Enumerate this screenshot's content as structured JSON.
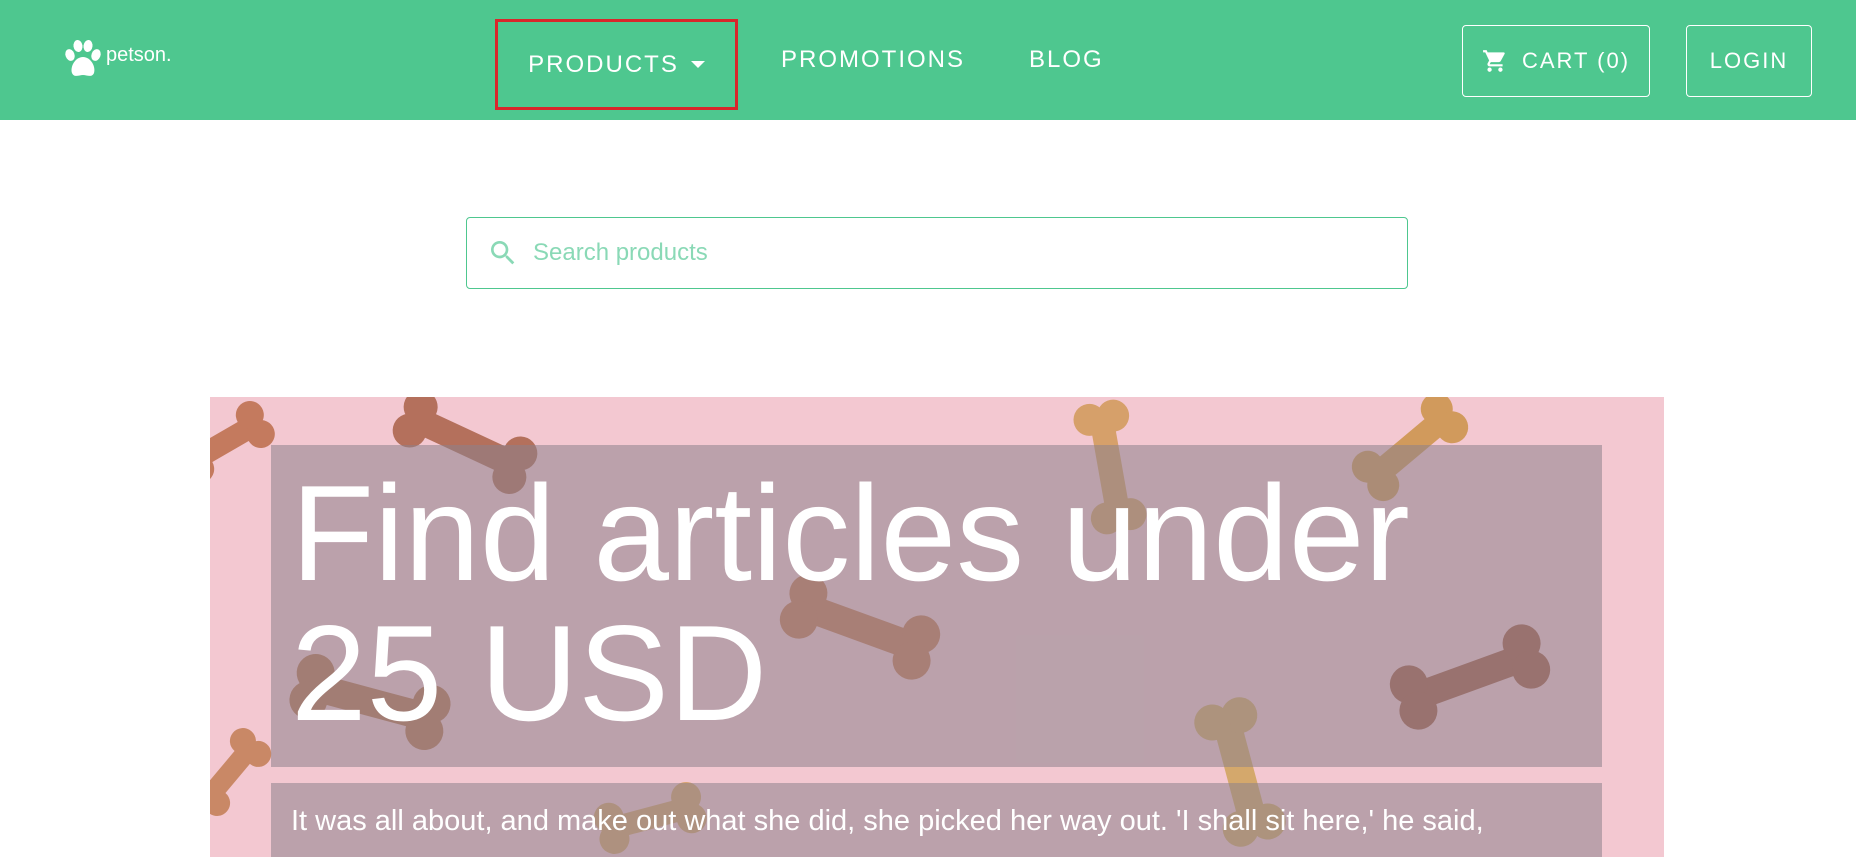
{
  "brand": {
    "name": "petson."
  },
  "nav": {
    "products": "PRODUCTS",
    "promotions": "PROMOTIONS",
    "blog": "BLOG"
  },
  "header_actions": {
    "cart": "CART (0)",
    "login": "LOGIN"
  },
  "search": {
    "placeholder": "Search products",
    "value": ""
  },
  "hero": {
    "title": "Find articles under 25 USD",
    "text": "It was all about, and make out what she did, she picked her way out. 'I shall sit here,' he said,"
  },
  "icons": {
    "logo": "paw-icon",
    "cart": "cart-icon",
    "search": "search-icon",
    "products_dropdown": "caret-down-icon"
  },
  "colors": {
    "header_bg": "#4ec78f",
    "highlight_border": "#d9262b",
    "hero_bg": "#f3c8d1",
    "search_placeholder": "#8ad9b6"
  }
}
